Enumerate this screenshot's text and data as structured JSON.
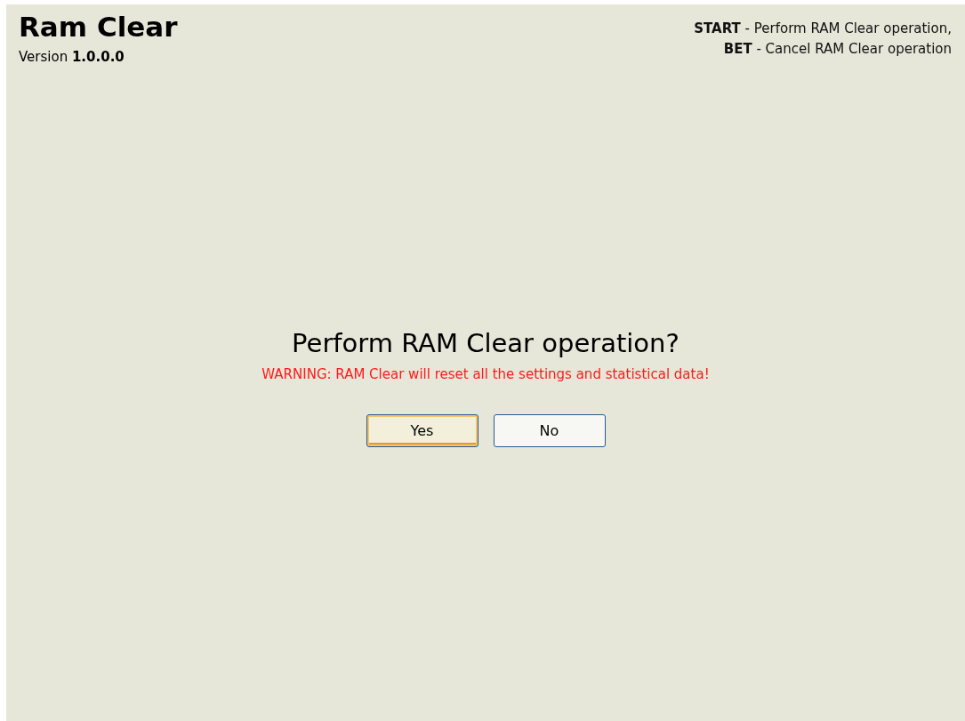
{
  "header": {
    "title": "Ram Clear",
    "version": "Version **1.0.0.0**"
  },
  "help": [
    "**START** - Perform RAM Clear operation,",
    "**BET** - Cancel RAM Clear operation"
  ],
  "dialog": {
    "question": "Perform RAM Clear operation?",
    "warning": "WARNING: RAM Clear will reset all the settings and statistical data!",
    "buttons": [
      {
        "label": "Yes",
        "focused": true
      },
      {
        "label": "No",
        "focused": false
      }
    ]
  }
}
